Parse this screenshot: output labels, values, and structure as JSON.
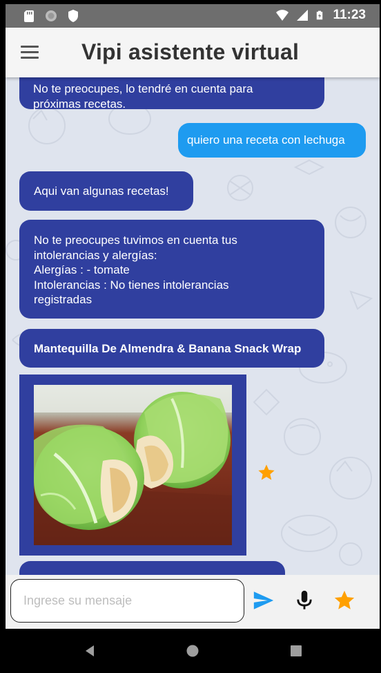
{
  "status_bar": {
    "time": "11:23",
    "left_icons": [
      "sd-card-icon",
      "circle-icon",
      "shield-icon"
    ],
    "right_icons": [
      "wifi-icon",
      "signal-icon",
      "battery-icon"
    ]
  },
  "app_bar": {
    "title": "Vipi asistente virtual",
    "menu_icon": "hamburger-menu-icon"
  },
  "messages": [
    {
      "from": "bot",
      "text": "No te preocupes, lo tendré en cuenta para\npróximas recetas."
    },
    {
      "from": "user",
      "text": "quiero una receta con lechuga"
    },
    {
      "from": "bot",
      "text": "Aqui van algunas recetas!"
    },
    {
      "from": "bot",
      "text": "No te preocupes tuvimos en cuenta tus\nintolerancias y alergías:\n Alergías :  - tomate\nIntolerancias :  No tienes intolerancias\nregistradas"
    },
    {
      "from": "bot",
      "text": "Mantequilla De Almendra & Banana Snack Wrap"
    }
  ],
  "recipe_card": {
    "image_desc_icon": "lettuce-wrap-photo",
    "favorite_icon": "star-icon"
  },
  "input": {
    "placeholder": "Ingrese su mensaje",
    "value": ""
  },
  "actions": {
    "send_icon": "send-icon",
    "mic_icon": "microphone-icon",
    "favorites_icon": "star-icon"
  },
  "nav": {
    "back_icon": "back-triangle-icon",
    "home_icon": "home-circle-icon",
    "recents_icon": "recents-square-icon"
  },
  "colors": {
    "bot_bubble": "#303f9f",
    "user_bubble": "#1e9bf0",
    "star": "#ffa000",
    "send": "#1e9bf0",
    "chat_bg": "#dfe4ee"
  }
}
